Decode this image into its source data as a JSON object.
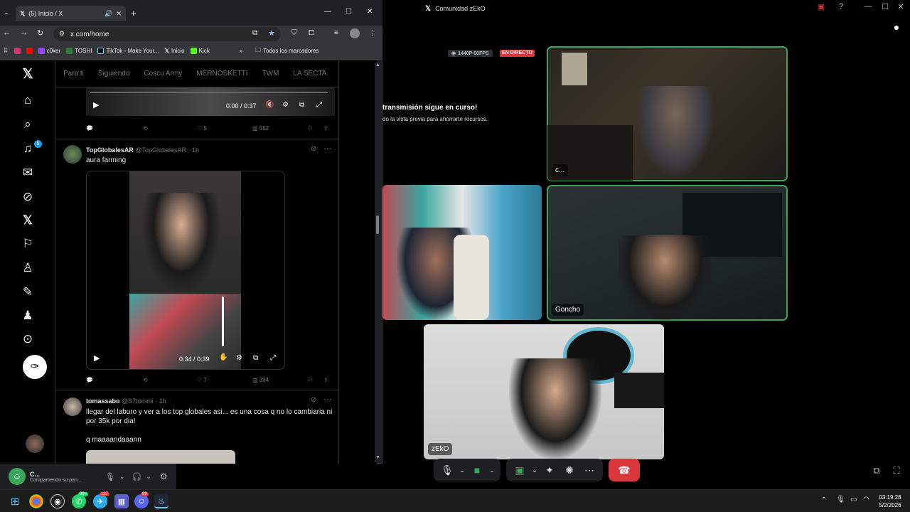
{
  "discord": {
    "window_title": "Comunidad zEkO",
    "quality_badge": "1440P 60FPS",
    "live_badge": "EN DIRECTO",
    "notice_title": "transmisión sigue en curso!",
    "notice_body": "do la vista previa para ahorrarte recursos.",
    "tiles": [
      {
        "name": "c..."
      },
      {
        "name": ""
      },
      {
        "name": "Goncho"
      },
      {
        "name": "zEkO"
      }
    ],
    "user_panel": {
      "name": "C...",
      "status": "Compartiendo su pan..."
    }
  },
  "browser": {
    "tab_title": "(5) Inicio / X",
    "url": "x.com/home",
    "bookmarks": [
      "c0ker",
      "TOSHI",
      "TikTok - Make Your...",
      "Inicio",
      "Kick"
    ],
    "all_bookmarks": "Todos los marcadores"
  },
  "x": {
    "feed_tabs": [
      "Para ti",
      "Siguiendo",
      "Coscu Army",
      "MERNOSKETTI",
      "TWM",
      "LA SECTA"
    ],
    "notification_count": "5",
    "video1": {
      "time": "0:00 / 0:37",
      "likes": "5",
      "views": "552"
    },
    "tweet1": {
      "name": "TopGlobalesAR",
      "handle": "@TopGlobalesAR · 1h",
      "text": "aura farming",
      "video_time": "0:34 / 0:39",
      "likes": "7",
      "views": "394"
    },
    "tweet2": {
      "name": "tomassabo",
      "handle": "@S7tommi · 1h",
      "text": "llegar del laburo y ver a los top globales asi... es una cosa q no lo cambiaria ni por 35k por dia!",
      "text2": "q maaaandaaann"
    }
  },
  "taskbar": {
    "time": "03:19:28",
    "date": "5/2/2026",
    "badge_whatsapp": "99+",
    "badge_mail": "127",
    "badge_discord": "99"
  },
  "colors": {
    "accent_red": "#da373c",
    "speaking_green": "#3ba55c",
    "x_blue": "#1d9bf0"
  }
}
